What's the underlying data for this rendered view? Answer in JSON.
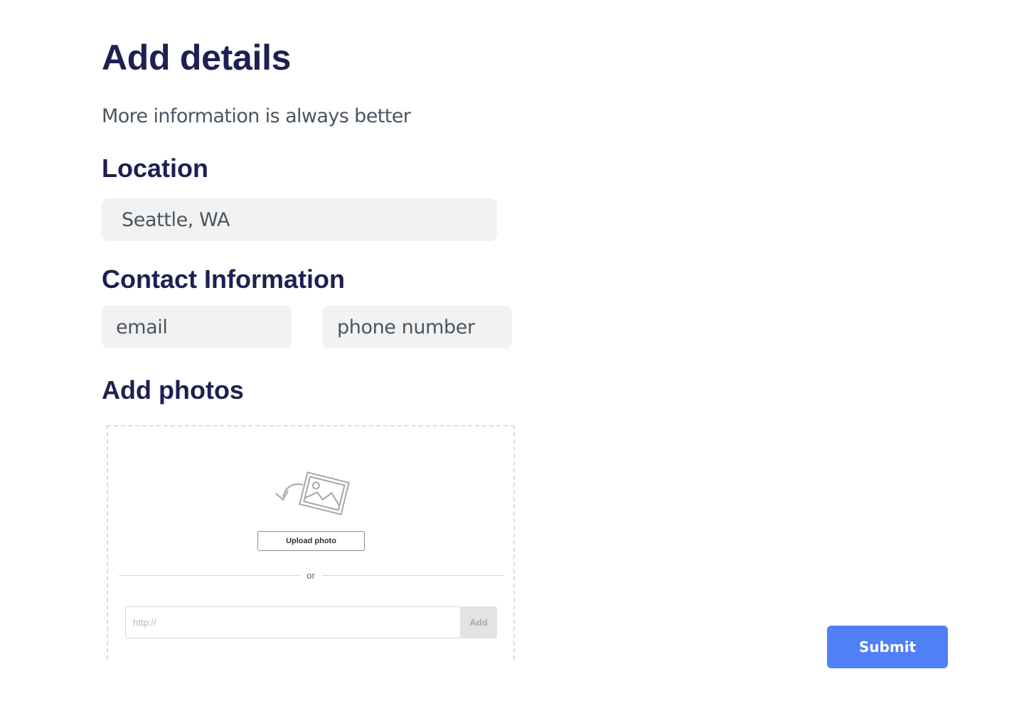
{
  "header": {
    "title": "Add details",
    "subtitle": "More information is always better"
  },
  "location": {
    "heading": "Location",
    "value": "Seattle, WA"
  },
  "contact": {
    "heading": "Contact Information",
    "email_placeholder": "email",
    "phone_placeholder": "phone number"
  },
  "photos": {
    "heading": "Add photos",
    "icon": "image-upload-icon",
    "upload_label": "Upload photo",
    "or_label": "or",
    "url_placeholder": "http://",
    "add_label": "Add"
  },
  "actions": {
    "submit_label": "Submit"
  },
  "colors": {
    "heading": "#1e1f52",
    "body_text": "#4a5560",
    "field_bg": "#f2f2f2",
    "primary": "#4f80f7"
  }
}
